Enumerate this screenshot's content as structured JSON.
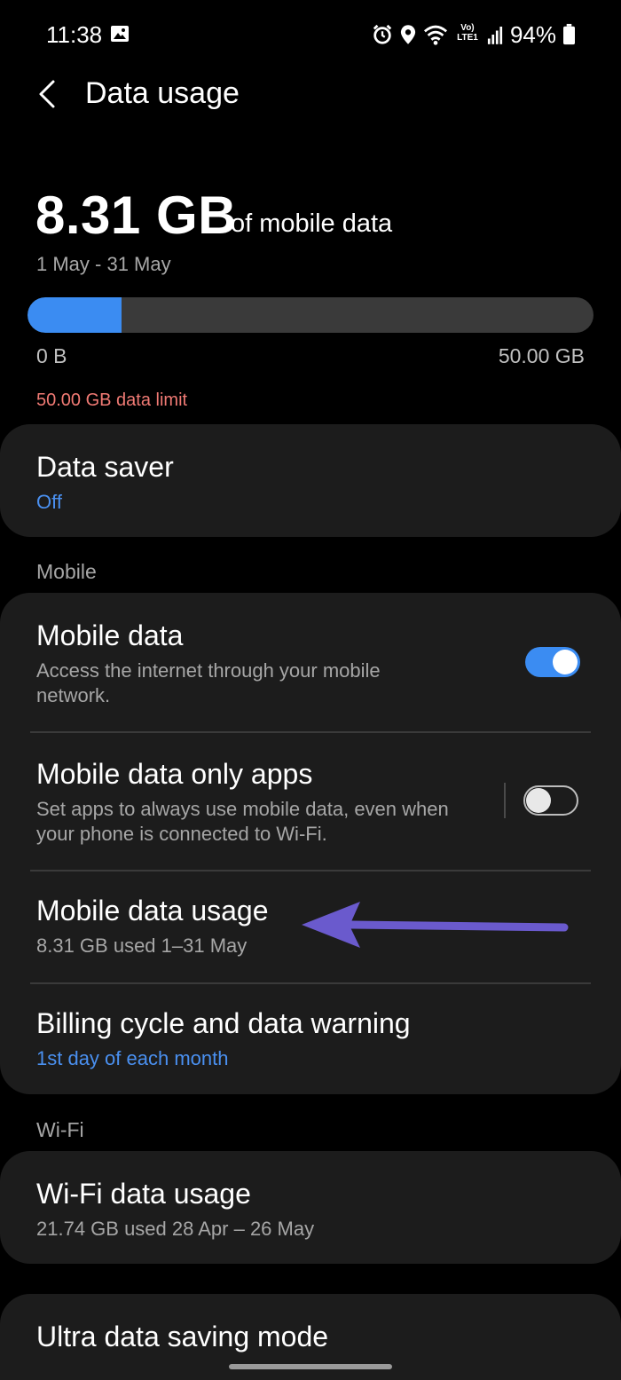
{
  "status_bar": {
    "time": "11:38",
    "battery": "94%",
    "icons": [
      "gallery-icon",
      "alarm-icon",
      "location-icon",
      "wifi-icon",
      "volte-lte-icon",
      "signal-icon",
      "battery-icon"
    ],
    "volte_label": "Vo) LTE1"
  },
  "header": {
    "title": "Data usage"
  },
  "usage": {
    "amount": "8.31 GB",
    "suffix": "of mobile data",
    "period": "1 May - 31 May",
    "progress_fraction": 0.166,
    "min_label": "0 B",
    "max_label": "50.00 GB",
    "limit_text": "50.00 GB data limit"
  },
  "data_saver": {
    "title": "Data saver",
    "status": "Off"
  },
  "mobile_section": {
    "label": "Mobile",
    "mobile_data": {
      "title": "Mobile data",
      "subtitle": "Access the internet through your mobile network.",
      "enabled": true
    },
    "mobile_only_apps": {
      "title": "Mobile data only apps",
      "subtitle": "Set apps to always use mobile data, even when your phone is connected to Wi-Fi.",
      "enabled": false
    },
    "mobile_usage": {
      "title": "Mobile data usage",
      "subtitle": "8.31 GB used 1–31 May"
    },
    "billing": {
      "title": "Billing cycle and data warning",
      "subtitle": "1st day of each month"
    }
  },
  "wifi_section": {
    "label": "Wi-Fi",
    "wifi_usage": {
      "title": "Wi-Fi data usage",
      "subtitle": "21.74 GB used 28 Apr – 26 May"
    }
  },
  "ultra": {
    "title": "Ultra data saving mode"
  },
  "colors": {
    "accent": "#3b8cf2",
    "limit_red": "#f07a74",
    "arrow": "#6a5acd",
    "card": "#1c1c1c"
  }
}
